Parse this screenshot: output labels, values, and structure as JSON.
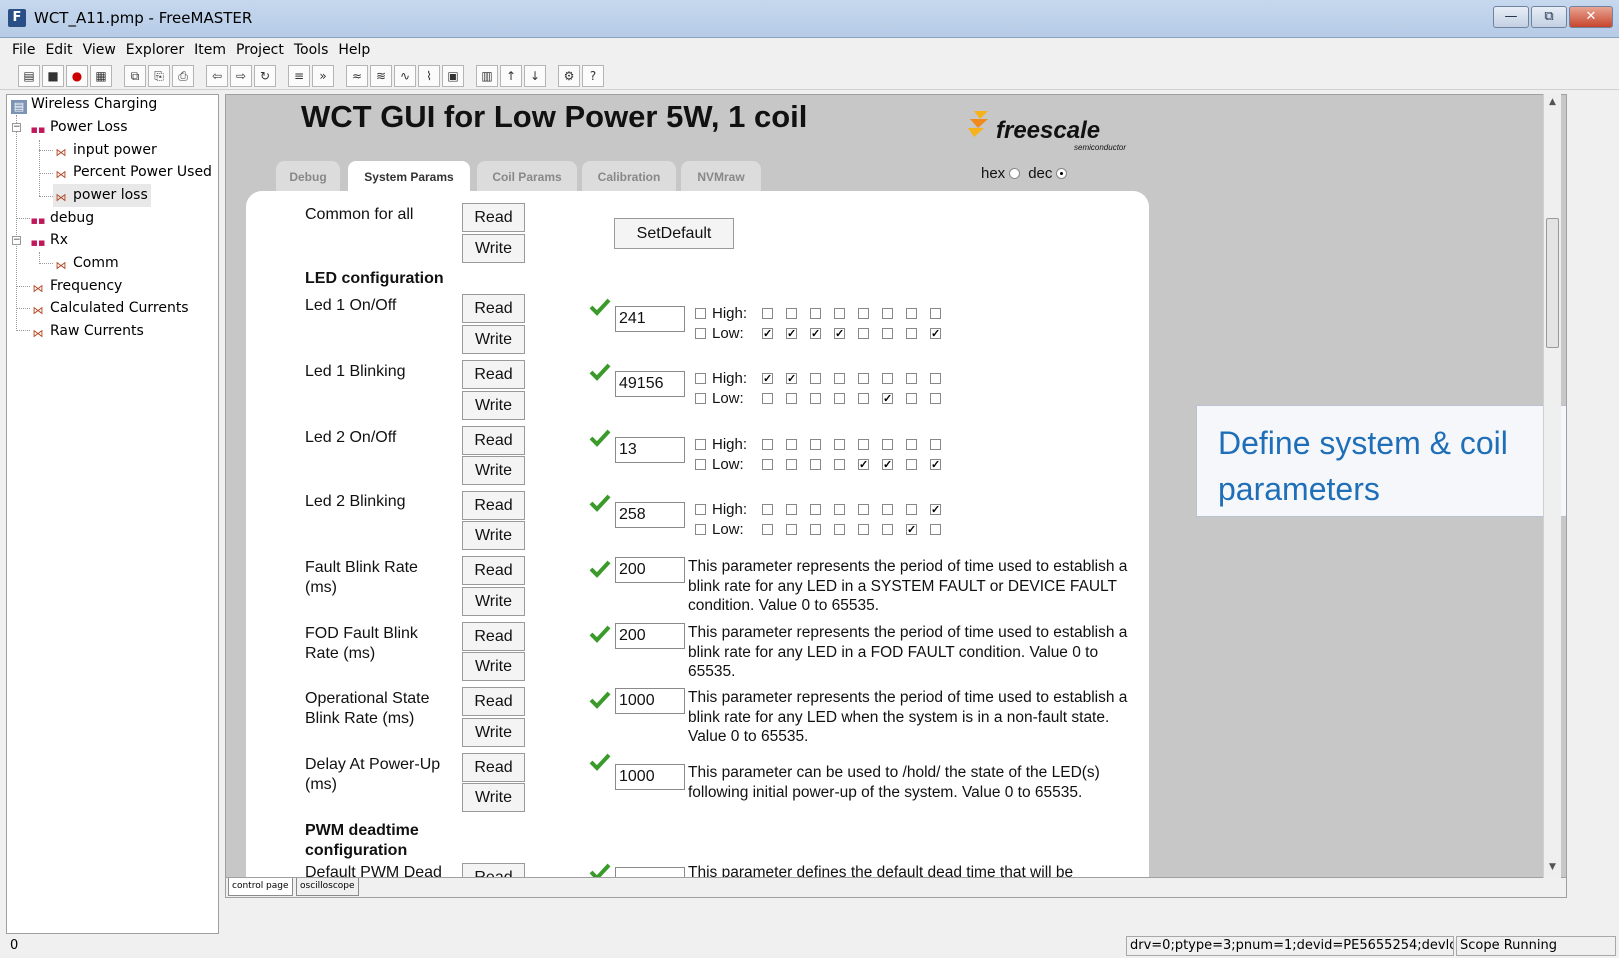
{
  "window": {
    "title": "WCT_A11.pmp - FreeMASTER",
    "minimize": "—",
    "maximize": "⧉",
    "close": "✕"
  },
  "menu": [
    "File",
    "Edit",
    "View",
    "Explorer",
    "Item",
    "Project",
    "Tools",
    "Help"
  ],
  "tree": {
    "root": "Wireless Charging",
    "power_loss": "Power Loss",
    "input_power": "input power",
    "percent_power_used": "Percent Power Used",
    "power_loss_var": "power loss",
    "debug": "debug",
    "rx": "Rx",
    "comm": "Comm",
    "frequency": "Frequency",
    "calculated_currents": "Calculated Currents",
    "raw_currents": "Raw Currents"
  },
  "gui": {
    "title": "WCT GUI for Low Power 5W, 1 coil",
    "logo_word": "freescale",
    "logo_sub": "semiconductor",
    "tabs": [
      "Debug",
      "System Params",
      "Coil Params",
      "Calibration",
      "NVMraw"
    ],
    "active_tab": "System Params",
    "radix_hex": "hex",
    "radix_dec": "dec",
    "radix_selected": "dec"
  },
  "labels": {
    "read": "Read",
    "write": "Write",
    "high": "High:",
    "low": "Low:",
    "set_default": "SetDefault"
  },
  "params": {
    "common": "Common for all",
    "led_section": "LED configuration",
    "led1_onoff": "Led 1 On/Off",
    "led1_onoff_value": "241",
    "led1_blink": "Led 1 Blinking",
    "led1_blink_value": "49156",
    "led2_onoff": "Led 2 On/Off",
    "led2_onoff_value": "13",
    "led2_blink": "Led 2 Blinking",
    "led2_blink_value": "258",
    "fault_blink_label": "Fault Blink Rate (ms)",
    "fault_blink_value": "200",
    "fault_blink_desc": "This parameter represents the period of time used to establish a blink rate for any LED in a SYSTEM FAULT or DEVICE FAULT condition. Value 0 to 65535.",
    "fod_blink_label": "FOD Fault Blink Rate (ms)",
    "fod_blink_value": "200",
    "fod_blink_desc": "This parameter represents the period of time used to establish a blink rate for any LED in a FOD FAULT condition. Value 0 to 65535.",
    "op_blink_label": "Operational State Blink Rate (ms)",
    "op_blink_value": "1000",
    "op_blink_desc": "This parameter represents the period of time used to establish a blink rate for any LED when the system is in a non-fault state. Value 0 to 65535.",
    "delay_label": "Delay At Power-Up (ms)",
    "delay_value": "1000",
    "delay_desc": "This parameter can be used to /hold/ the state of the LED(s) following initial power-up of the system. Value 0 to 65535.",
    "pwm_section": "PWM deadtime configuration",
    "pwm_default_label": "Default PWM Dead",
    "pwm_default_desc": "This parameter defines the default dead time that will be"
  },
  "bits": {
    "led1_onoff": {
      "high": [
        0,
        0,
        0,
        0,
        0,
        0,
        0,
        0
      ],
      "low": [
        1,
        1,
        1,
        1,
        0,
        0,
        0,
        1
      ]
    },
    "led1_blink": {
      "high": [
        1,
        1,
        0,
        0,
        0,
        0,
        0,
        0
      ],
      "low": [
        0,
        0,
        0,
        0,
        0,
        1,
        0,
        0
      ]
    },
    "led2_onoff": {
      "high": [
        0,
        0,
        0,
        0,
        0,
        0,
        0,
        0
      ],
      "low": [
        0,
        0,
        0,
        0,
        1,
        1,
        0,
        1
      ]
    },
    "led2_blink": {
      "high": [
        0,
        0,
        0,
        0,
        0,
        0,
        0,
        1
      ],
      "low": [
        0,
        0,
        0,
        0,
        0,
        0,
        1,
        0
      ]
    }
  },
  "callout": "Define system & coil parameters",
  "bottom_tabs": [
    "control page",
    "oscilloscope"
  ],
  "status": {
    "left": "0",
    "connection": "drv=0;ptype=3;pnum=1;devid=PE5655254;devlock=C",
    "scope": "Scope Running"
  }
}
